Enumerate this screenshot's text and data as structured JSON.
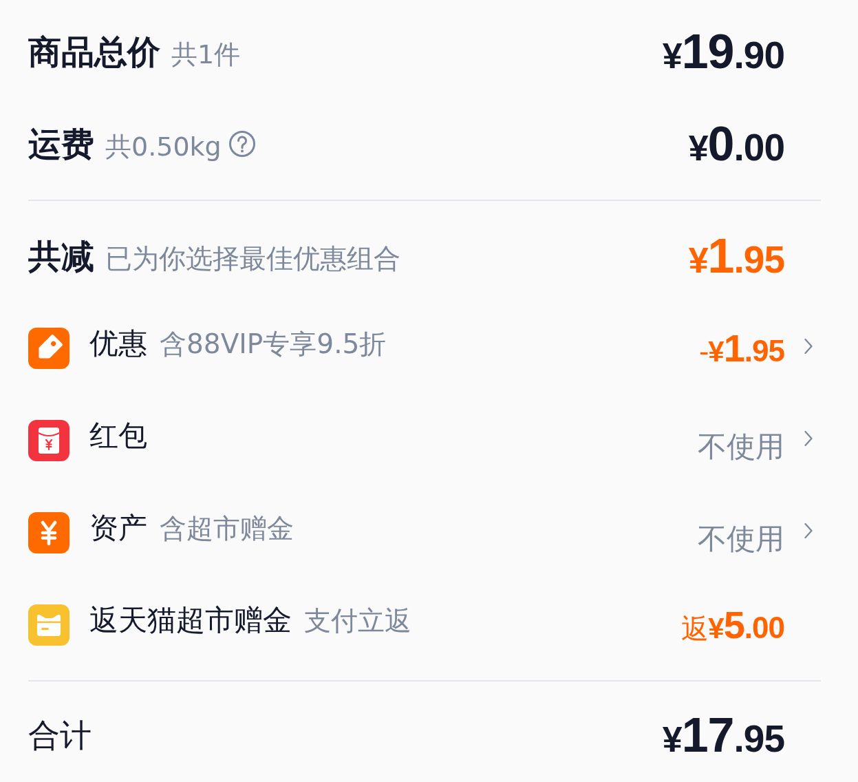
{
  "summary": [
    {
      "label": "商品总价",
      "note": "共1件",
      "help": false,
      "price": {
        "symbol": "¥",
        "integer": "19",
        "fraction": ".90"
      }
    },
    {
      "label": "运费",
      "note": "共0.50kg",
      "help": true,
      "price": {
        "symbol": "¥",
        "integer": "0",
        "fraction": ".00"
      }
    }
  ],
  "discount": {
    "label": "共减",
    "note": "已为你选择最佳优惠组合",
    "price": {
      "symbol": "¥",
      "integer": "1",
      "fraction": ".95"
    }
  },
  "benefits": [
    {
      "kind": "tag",
      "label": "优惠",
      "note": "含88VIP专享9.5折",
      "value": {
        "kind": "amount",
        "prefix": "-",
        "symbol": "¥",
        "integer": "1",
        "fraction": ".95"
      },
      "chevron": true
    },
    {
      "kind": "packet",
      "label": "红包",
      "value": {
        "kind": "text",
        "text": "不使用"
      },
      "chevron": true
    },
    {
      "kind": "yen",
      "label": "资产",
      "note": "含超市赠金",
      "value": {
        "kind": "text",
        "text": "不使用"
      },
      "chevron": true
    },
    {
      "kind": "card",
      "label": "返天猫超市赠金",
      "note": "支付立返",
      "value": {
        "kind": "amount",
        "prefix": "返",
        "symbol": "¥",
        "integer": "5",
        "fraction": ".00"
      },
      "chevron": false
    }
  ],
  "total": {
    "label": "合计",
    "price": {
      "symbol": "¥",
      "integer": "17",
      "fraction": ".95"
    }
  }
}
